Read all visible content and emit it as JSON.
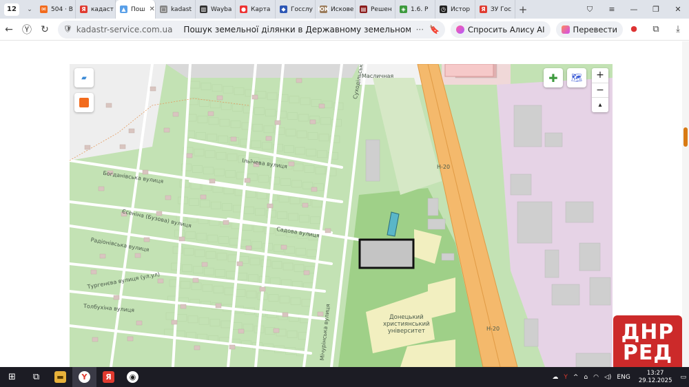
{
  "tabbar": {
    "count": "12",
    "tabs": [
      {
        "label": "504 · В",
        "color": "#f26b1d",
        "icon": "mail-icon",
        "glyph": "✉"
      },
      {
        "label": "кадаст",
        "color": "#e03a2f",
        "icon": "yandex-icon",
        "glyph": "Я"
      },
      {
        "label": "Пош",
        "color": "#5aa0e8",
        "icon": "kadastr-icon",
        "glyph": "▲",
        "active": true,
        "close": "✕"
      },
      {
        "label": "kadast",
        "color": "#888",
        "icon": "page-icon",
        "glyph": "□"
      },
      {
        "label": "Wayba",
        "color": "#333",
        "icon": "archive-icon",
        "glyph": "▥"
      },
      {
        "label": "Карта",
        "color": "#e33",
        "icon": "map-pin-icon",
        "glyph": "●"
      },
      {
        "label": "Госслу",
        "color": "#2d57b5",
        "icon": "gov-icon",
        "glyph": "◆"
      },
      {
        "label": "Искове",
        "color": "#9a7b5a",
        "icon": "law-icon",
        "glyph": "ЮК"
      },
      {
        "label": "Решен",
        "color": "#8b1c1c",
        "icon": "court-icon",
        "glyph": "▤"
      },
      {
        "label": "1.6. Р",
        "color": "#3d9a3d",
        "icon": "doc-icon",
        "glyph": "◈"
      },
      {
        "label": "Истор",
        "color": "#222",
        "icon": "history-icon",
        "glyph": "◷"
      },
      {
        "label": "ЗУ Гос",
        "color": "#e03a2f",
        "icon": "yandex-icon",
        "glyph": "Я"
      }
    ],
    "add": "+"
  },
  "addressbar": {
    "domain": "kadastr-service.com.ua",
    "title": "Пошук земельної ділянки в Державному земельному кадастрі по...",
    "alice": "Спросить Алису AI",
    "translate": "Перевести",
    "more": "···"
  },
  "map": {
    "streets": {
      "bogdan": "Богданівська вулиця",
      "ilyich": "Ільїчева вулиця",
      "sadovaya": "Садова вулиця",
      "esenina": "Єсеніна (Бузова) вулиця",
      "radionovskaya": "Радіонівська вулиця",
      "turgenev": "Тургенєва вулиця (ул.ул)",
      "tolbuhina": "Толбухіна вулиця",
      "mashino": "Масличная",
      "suhodolska": "Суходільська вулиця",
      "michurina": "Мічурінська вулиця",
      "h20a": "H-20",
      "h20b": "H-20"
    },
    "university": [
      "Донецький",
      "християнський",
      "університет"
    ],
    "zoom_in": "+",
    "zoom_out": "−",
    "compass": "▴"
  },
  "watermark": {
    "line1": "ДНР",
    "line2": "РЕД"
  },
  "taskbar": {
    "lang": "ENG",
    "time": "13:27",
    "date": "29.12.2025"
  },
  "colors": {
    "accent": "#f26b1d",
    "parcel": "#5ab6c8"
  }
}
